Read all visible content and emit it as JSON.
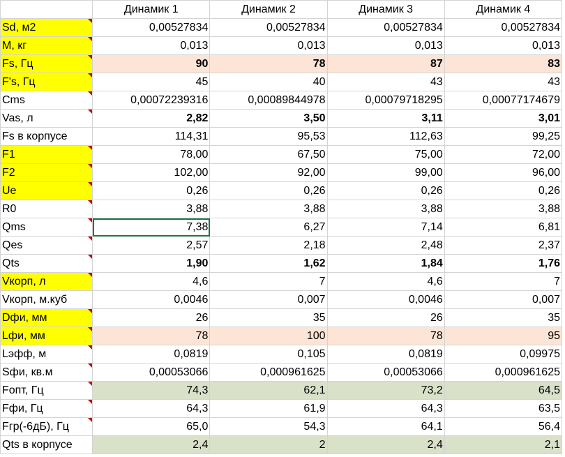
{
  "header": [
    "",
    "Динамик 1",
    "Динамик 2",
    "Динамик 3",
    "Динамик 4"
  ],
  "colors": {
    "yellow": "#ffff00",
    "peach": "#fce4d6",
    "green": "#d9e1c9",
    "selection": "#217346",
    "comment_marker": "#c00000"
  },
  "rows": [
    {
      "label": "Sd, м2",
      "values": [
        "0,00527834",
        "0,00527834",
        "0,00527834",
        "0,00527834"
      ],
      "label_bg": "yellow",
      "value_bg": "",
      "bold": false,
      "comment": true
    },
    {
      "label": "M, кг",
      "values": [
        "0,013",
        "0,013",
        "0,013",
        "0,013"
      ],
      "label_bg": "yellow",
      "value_bg": "",
      "bold": false,
      "comment": true
    },
    {
      "label": "Fs, Гц",
      "values": [
        "90",
        "78",
        "87",
        "83"
      ],
      "label_bg": "yellow",
      "value_bg": "peach",
      "bold": true,
      "comment": true
    },
    {
      "label": "F's, Гц",
      "values": [
        "45",
        "40",
        "43",
        "43"
      ],
      "label_bg": "yellow",
      "value_bg": "",
      "bold": false,
      "comment": true
    },
    {
      "label": "Cms",
      "values": [
        "0,00072239316",
        "0,00089844978",
        "0,00079718295",
        "0,00077174679"
      ],
      "label_bg": "",
      "value_bg": "",
      "bold": false,
      "comment": true
    },
    {
      "label": "Vas, л",
      "values": [
        "2,82",
        "3,50",
        "3,11",
        "3,01"
      ],
      "label_bg": "",
      "value_bg": "",
      "bold": true,
      "comment": true
    },
    {
      "label": "Fs  в корпусе",
      "values": [
        "114,31",
        "95,53",
        "112,63",
        "99,25"
      ],
      "label_bg": "",
      "value_bg": "",
      "bold": false,
      "comment": false
    },
    {
      "label": "F1",
      "values": [
        "78,00",
        "67,50",
        "75,00",
        "72,00"
      ],
      "label_bg": "yellow",
      "value_bg": "",
      "bold": false,
      "comment": true
    },
    {
      "label": "F2",
      "values": [
        "102,00",
        "92,00",
        "99,00",
        "96,00"
      ],
      "label_bg": "yellow",
      "value_bg": "",
      "bold": false,
      "comment": true
    },
    {
      "label": "Ue",
      "values": [
        "0,26",
        "0,26",
        "0,26",
        "0,26"
      ],
      "label_bg": "yellow",
      "value_bg": "",
      "bold": false,
      "comment": true
    },
    {
      "label": "R0",
      "values": [
        "3,88",
        "3,88",
        "3,88",
        "3,88"
      ],
      "label_bg": "",
      "value_bg": "",
      "bold": false,
      "comment": true
    },
    {
      "label": "Qms",
      "values": [
        "7,38",
        "6,27",
        "7,14",
        "6,81"
      ],
      "label_bg": "",
      "value_bg": "",
      "bold": false,
      "comment": true,
      "selected_col": 0
    },
    {
      "label": "Qes",
      "values": [
        "2,57",
        "2,18",
        "2,48",
        "2,37"
      ],
      "label_bg": "",
      "value_bg": "",
      "bold": false,
      "comment": true
    },
    {
      "label": "Qts",
      "values": [
        "1,90",
        "1,62",
        "1,84",
        "1,76"
      ],
      "label_bg": "",
      "value_bg": "",
      "bold": true,
      "comment": true
    },
    {
      "label": "Vкорп, л",
      "values": [
        "4,6",
        "7",
        "4,6",
        "7"
      ],
      "label_bg": "yellow",
      "value_bg": "",
      "bold": false,
      "comment": true
    },
    {
      "label": "Vкорп, м.куб",
      "values": [
        "0,0046",
        "0,007",
        "0,0046",
        "0,007"
      ],
      "label_bg": "",
      "value_bg": "",
      "bold": false,
      "comment": false
    },
    {
      "label": "Dфи, мм",
      "values": [
        "26",
        "35",
        "26",
        "35"
      ],
      "label_bg": "yellow",
      "value_bg": "",
      "bold": false,
      "comment": true
    },
    {
      "label": "Lфи, мм",
      "values": [
        "78",
        "100",
        "78",
        "95"
      ],
      "label_bg": "yellow",
      "value_bg": "peach",
      "bold": false,
      "comment": true
    },
    {
      "label": "Lэфф, м",
      "values": [
        "0,0819",
        "0,105",
        "0,0819",
        "0,09975"
      ],
      "label_bg": "",
      "value_bg": "",
      "bold": false,
      "comment": true
    },
    {
      "label": "Sфи, кв.м",
      "values": [
        "0,00053066",
        "0,000961625",
        "0,00053066",
        "0,000961625"
      ],
      "label_bg": "",
      "value_bg": "",
      "bold": false,
      "comment": true
    },
    {
      "label": "Fопт, Гц",
      "values": [
        "74,3",
        "62,1",
        "73,2",
        "64,5"
      ],
      "label_bg": "",
      "value_bg": "green",
      "bold": false,
      "comment": true
    },
    {
      "label": "Fфи, Гц",
      "values": [
        "64,3",
        "61,9",
        "64,3",
        "63,5"
      ],
      "label_bg": "",
      "value_bg": "",
      "bold": false,
      "comment": true
    },
    {
      "label": "Fгр(-6дБ), Гц",
      "values": [
        "65,0",
        "54,3",
        "64,1",
        "56,4"
      ],
      "label_bg": "",
      "value_bg": "",
      "bold": false,
      "comment": true
    },
    {
      "label": "Qts в корпусе",
      "values": [
        "2,4",
        "2",
        "2,4",
        "2,1"
      ],
      "label_bg": "",
      "value_bg": "green",
      "bold": false,
      "comment": false
    }
  ]
}
